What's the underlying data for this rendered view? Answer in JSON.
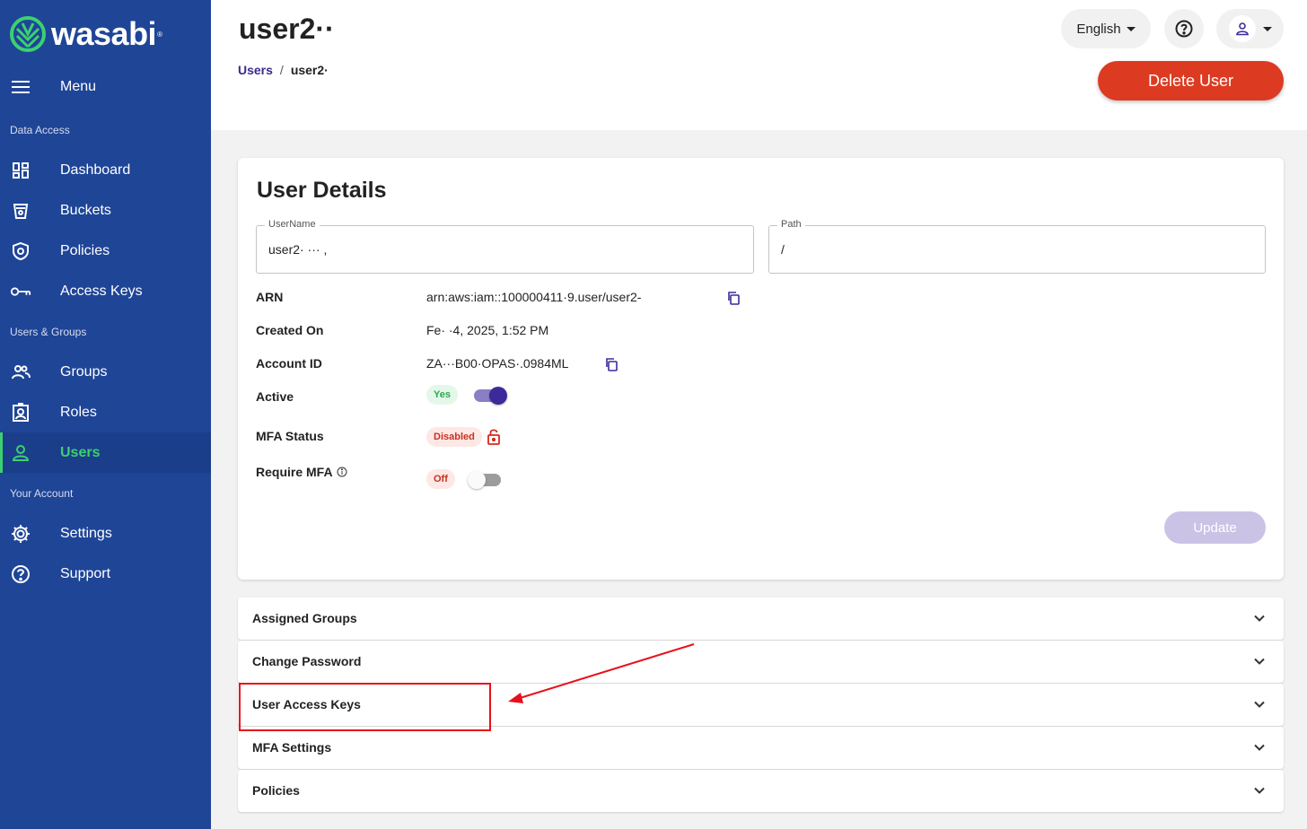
{
  "app": {
    "brand": "wasabi",
    "brand_mark": "®"
  },
  "sidebar": {
    "menu_label": "Menu",
    "sections": {
      "data_access": "Data Access",
      "users_groups": "Users & Groups",
      "your_account": "Your Account"
    },
    "items": [
      {
        "label": "Dashboard",
        "icon": "dashboard-icon"
      },
      {
        "label": "Buckets",
        "icon": "bucket-icon"
      },
      {
        "label": "Policies",
        "icon": "shield-icon"
      },
      {
        "label": "Access Keys",
        "icon": "key-icon"
      },
      {
        "label": "Groups",
        "icon": "groups-icon"
      },
      {
        "label": "Roles",
        "icon": "badge-icon"
      },
      {
        "label": "Users",
        "icon": "user-icon",
        "active": true
      },
      {
        "label": "Settings",
        "icon": "gear-icon"
      },
      {
        "label": "Support",
        "icon": "help-circle-icon"
      }
    ]
  },
  "header": {
    "title": "user2··",
    "breadcrumb": {
      "parent": "Users",
      "separator": "/",
      "current": "user2·"
    },
    "language": "English",
    "delete_label": "Delete User"
  },
  "details": {
    "title": "User Details",
    "username_label": "UserName",
    "username_value": "user2· ··· ,",
    "path_label": "Path",
    "path_value": "/",
    "arn_label": "ARN",
    "arn_value": "arn:aws:iam::100000411·9.user/user2-",
    "created_label": "Created On",
    "created_value": "Fe· ·4, 2025, 1:52 PM",
    "account_label": "Account ID",
    "account_value": "ZA···B00·OPAS·.0984ML",
    "active_label": "Active",
    "active_pill": "Yes",
    "active_on": true,
    "mfa_label": "MFA Status",
    "mfa_pill": "Disabled",
    "require_mfa_label": "Require MFA",
    "require_mfa_pill": "Off",
    "require_mfa_on": false,
    "update_label": "Update"
  },
  "accordions": [
    {
      "title": "Assigned Groups"
    },
    {
      "title": "Change Password"
    },
    {
      "title": "User Access Keys"
    },
    {
      "title": "MFA Settings"
    },
    {
      "title": "Policies"
    }
  ],
  "colors": {
    "sidebar_bg": "#1f4597",
    "active_green": "#3bd16f",
    "delete_red": "#dd3a22",
    "primary_purple": "#3c2a9a",
    "annotation_red": "#e8101a"
  }
}
